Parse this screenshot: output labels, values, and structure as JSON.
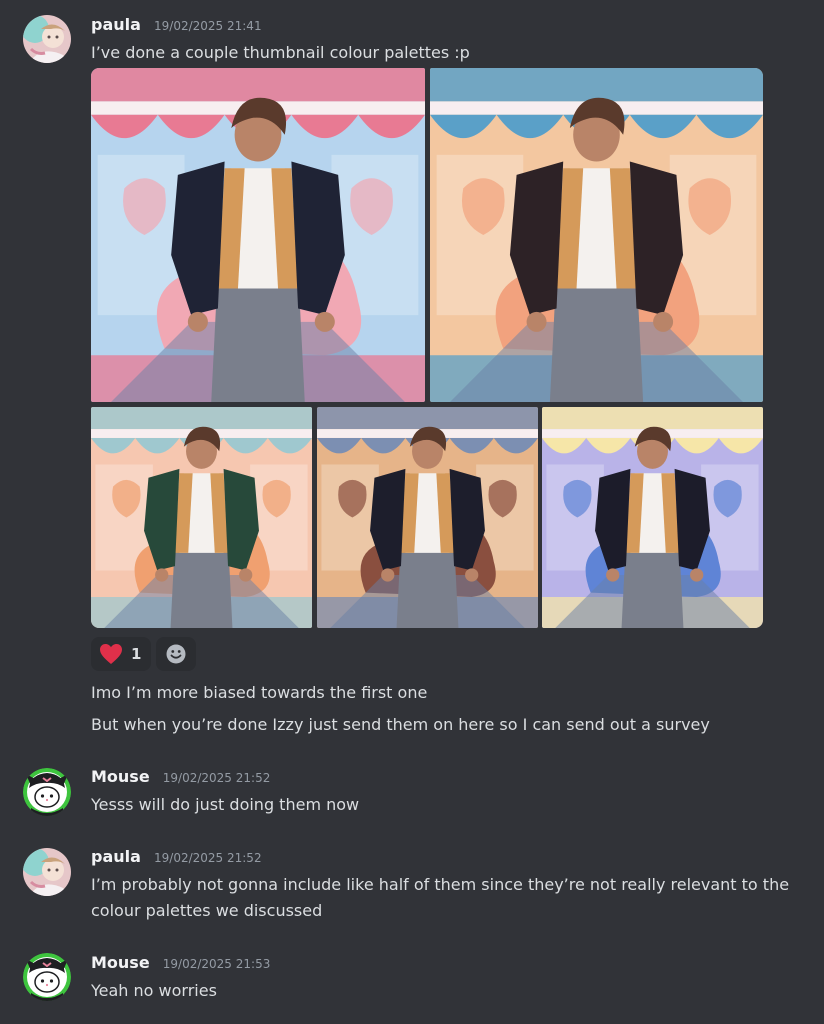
{
  "messages": [
    {
      "author": "paula",
      "timestamp": "19/02/2025 21:41",
      "avatar_icon": "pastel-avatar-icon",
      "text": "I’ve done a couple thumbnail colour palettes :p",
      "attachments": [
        {
          "palette": "pastel-pink-blue",
          "jacket": "#1f2335",
          "bg": "#b6d4ee",
          "awning": "#e87a93",
          "shell": "#f1a8b4"
        },
        {
          "palette": "warm-peach-yellow",
          "jacket": "#2d2226",
          "bg": "#f3c7a0",
          "awning": "#5aa0c8",
          "shell": "#f2a27e"
        },
        {
          "palette": "green-jacket",
          "jacket": "#27493a",
          "bg": "#f6c7b0",
          "awning": "#9fc8cf",
          "shell": "#f0a070"
        },
        {
          "palette": "muted-orange",
          "jacket": "#1d1e2c",
          "bg": "#e6b489",
          "awning": "#7c8fb2",
          "shell": "#8a4f3f"
        },
        {
          "palette": "lavender-blue",
          "jacket": "#1c1c2a",
          "bg": "#b9b3e8",
          "awning": "#f6e6a8",
          "shell": "#5f84d6"
        }
      ],
      "reactions": [
        {
          "emoji": "heart-icon",
          "count": "1"
        }
      ],
      "followups": [
        "Imo I’m more biased towards the first one",
        "But when you’re done Izzy just send them on here so I can send out a survey"
      ]
    },
    {
      "author": "Mouse",
      "timestamp": "19/02/2025 21:52",
      "avatar_icon": "kuromi-avatar-icon",
      "text": "Yesss will do just doing them now"
    },
    {
      "author": "paula",
      "timestamp": "19/02/2025 21:52",
      "avatar_icon": "pastel-avatar-icon",
      "text": "I’m probably not gonna include like half of them since they’re not really relevant to the colour palettes we discussed"
    },
    {
      "author": "Mouse",
      "timestamp": "19/02/2025 21:53",
      "avatar_icon": "kuromi-avatar-icon",
      "text": "Yeah no worries"
    }
  ],
  "colors": {
    "background": "#313338",
    "username": "#f2f3f5",
    "timestamp": "#949ba4",
    "text": "#dbdee1",
    "reaction_bg": "#2b2d31",
    "heart": "#e0304a",
    "mouse_ring": "#3ec43e"
  }
}
